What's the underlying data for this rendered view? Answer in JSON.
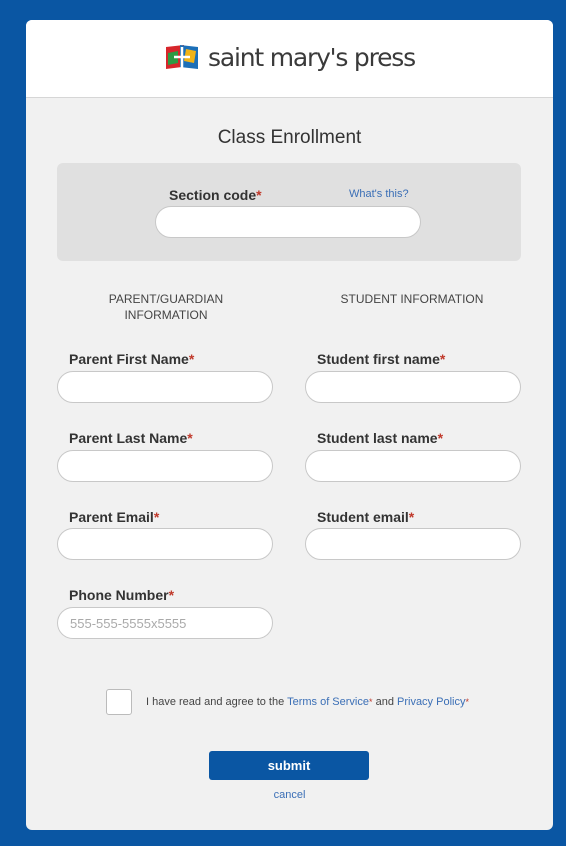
{
  "brand": {
    "name": "saint mary's press",
    "logo_icon": "smp-logo-icon"
  },
  "form": {
    "title": "Class Enrollment",
    "section_code": {
      "label": "Section code",
      "required": "*",
      "help_link": "What's this?",
      "value": ""
    },
    "parent_heading": "PARENT/GUARDIAN INFORMATION",
    "student_heading": "STUDENT INFORMATION",
    "parent_first": {
      "label": "Parent First Name",
      "required": "*",
      "value": ""
    },
    "parent_last": {
      "label": "Parent Last Name",
      "required": "*",
      "value": ""
    },
    "parent_email": {
      "label": "Parent Email",
      "required": "*",
      "value": ""
    },
    "phone": {
      "label": "Phone Number",
      "required": "*",
      "placeholder": "555-555-5555x5555",
      "value": ""
    },
    "student_first": {
      "label": "Student first name",
      "required": "*",
      "value": ""
    },
    "student_last": {
      "label": "Student last name",
      "required": "*",
      "value": ""
    },
    "student_email": {
      "label": "Student email",
      "required": "*",
      "value": ""
    },
    "agreement": {
      "prefix": "I have read and agree to the",
      "terms": "Terms of Service",
      "and": "and",
      "privacy": "Privacy Policy",
      "star": "*",
      "checked": false
    },
    "submit_label": "submit",
    "cancel_label": "cancel"
  },
  "colors": {
    "accent": "#0a56a3",
    "required": "#c0392b",
    "link": "#3b6fb6",
    "panel": "#f1f1f1"
  }
}
